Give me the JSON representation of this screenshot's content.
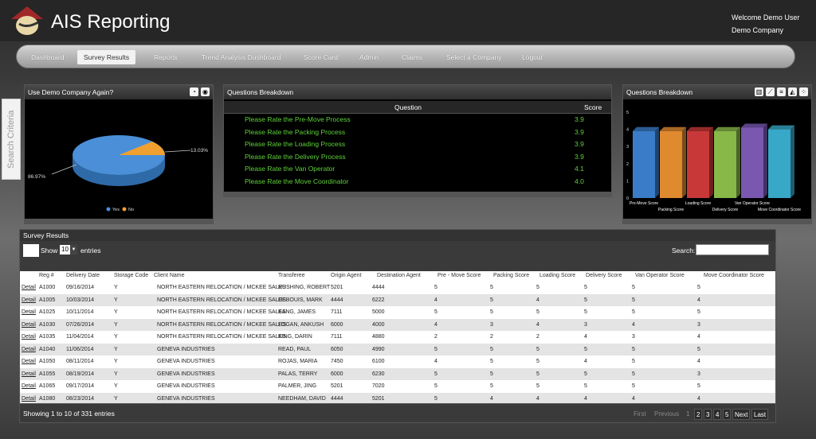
{
  "app": {
    "title": "AIS Reporting"
  },
  "user": {
    "welcome": "Welcome Demo User",
    "company": "Demo Company"
  },
  "nav": [
    "Dashboard",
    "Survey Results",
    "Reports",
    "Trend Analysis Dashboard",
    "Score Card",
    "Admin",
    "Claims",
    "Select a Company",
    "Logout"
  ],
  "nav_active": "Survey Results",
  "search_tab": "Search Criteria",
  "pie_panel": {
    "title": "Use Demo Company Again?",
    "yes_label": "86.97%",
    "no_label": "13.03%",
    "legend": [
      "Yes",
      "No"
    ],
    "colors": {
      "yes": "#4a8fd8",
      "no": "#f0a030"
    }
  },
  "questions_panel": {
    "title": "Questions Breakdown",
    "col_question": "Question",
    "col_score": "Score",
    "rows": [
      {
        "q": "Please Rate the Pre-Move Process",
        "s": "3.9"
      },
      {
        "q": "Please Rate the Packing Process",
        "s": "3.9"
      },
      {
        "q": "Please Rate the Loading Process",
        "s": "3.9"
      },
      {
        "q": "Please Rate the Delivery Process",
        "s": "3.9"
      },
      {
        "q": "Please Rate the Van Operator",
        "s": "4.1"
      },
      {
        "q": "Please Rate the Move Coordinator",
        "s": "4.0"
      }
    ]
  },
  "bar_panel": {
    "title": "Questions Breakdown",
    "colors": [
      "#3a7cc8",
      "#e08a30",
      "#c83838",
      "#88b848",
      "#7a58b0",
      "#38a8c8"
    ]
  },
  "chart_data": {
    "type": "bar",
    "categories": [
      "Pre-Move Score",
      "Packing Score",
      "Loading Score",
      "Delivery Score",
      "Van Operator Score",
      "Move Coordinator Score"
    ],
    "values": [
      3.9,
      3.9,
      3.9,
      3.9,
      4.1,
      4.0
    ],
    "ylim": [
      0,
      5
    ],
    "yticks": [
      "0",
      "1",
      "2",
      "3",
      "4",
      "5"
    ]
  },
  "results": {
    "title": "Survey Results",
    "show_label": "Show",
    "page_size": "10",
    "entries_label": "entries",
    "search_label": "Search:",
    "search_value": "",
    "columns": [
      "Reg #",
      "Delivery Date",
      "Storage Code",
      "Client Name",
      "Transferee",
      "Origin Agent",
      "Destination Agent",
      "Pre - Move Score",
      "Packing Score",
      "Loading Score",
      "Delivery Score",
      "Van Operator Score",
      "Move Coordinator Score"
    ],
    "detail_label": "Detail",
    "rows": [
      [
        "A1000",
        "09/16/2014",
        "Y",
        "NORTH EASTERN RELOCATION / MCKEE SALES",
        "RUSHING, ROBERT",
        "5201",
        "4444",
        "5",
        "5",
        "5",
        "5",
        "5",
        "5"
      ],
      [
        "A1005",
        "10/03/2014",
        "Y",
        "NORTH EASTERN RELOCATION / MCKEE SALES",
        "DEBOUIS, MARK",
        "4444",
        "6222",
        "4",
        "5",
        "4",
        "5",
        "5",
        "4"
      ],
      [
        "A1025",
        "10/11/2014",
        "Y",
        "NORTH EASTERN RELOCATION / MCKEE SALES",
        "KANG, JAMES",
        "7111",
        "5000",
        "5",
        "5",
        "5",
        "5",
        "5",
        "5"
      ],
      [
        "A1030",
        "07/26/2014",
        "Y",
        "NORTH EASTERN RELOCATION / MCKEE SALES",
        "LOGAN, ANKUSH",
        "6000",
        "4000",
        "4",
        "3",
        "4",
        "3",
        "4",
        "3"
      ],
      [
        "A1035",
        "11/04/2014",
        "Y",
        "NORTH EASTERN RELOCATION / MCKEE SALES",
        "KING, DARIN",
        "7111",
        "4880",
        "2",
        "2",
        "2",
        "4",
        "3",
        "4"
      ],
      [
        "A1040",
        "11/06/2014",
        "Y",
        "GENEVA INDUSTRIES",
        "READ, PAUL",
        "6050",
        "4990",
        "5",
        "5",
        "5",
        "5",
        "5",
        "5"
      ],
      [
        "A1050",
        "08/11/2014",
        "Y",
        "GENEVA INDUSTRIES",
        "ROJAS, MARIA",
        "7450",
        "6100",
        "4",
        "5",
        "5",
        "4",
        "5",
        "4"
      ],
      [
        "A1055",
        "08/19/2014",
        "Y",
        "GENEVA INDUSTRIES",
        "PALAS, TERRY",
        "6000",
        "6230",
        "5",
        "5",
        "5",
        "5",
        "5",
        "3"
      ],
      [
        "A1065",
        "09/17/2014",
        "Y",
        "GENEVA INDUSTRIES",
        "PALMER, JING",
        "5201",
        "7020",
        "5",
        "5",
        "5",
        "5",
        "5",
        "5"
      ],
      [
        "A1080",
        "08/23/2014",
        "Y",
        "GENEVA INDUSTRIES",
        "NEEDHAM, DAVID",
        "4444",
        "5201",
        "5",
        "4",
        "4",
        "4",
        "4",
        "4"
      ]
    ],
    "info": "Showing 1 to 10 of 331 entries",
    "pagination": {
      "first": "First",
      "previous": "Previous",
      "pages": [
        "1",
        "2",
        "3",
        "4",
        "5"
      ],
      "next": "Next",
      "last": "Last"
    }
  }
}
